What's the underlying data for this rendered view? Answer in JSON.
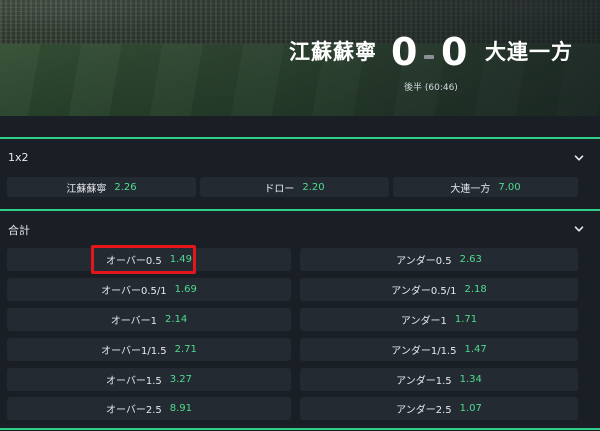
{
  "match": {
    "home_team": "江蘇蘇寧",
    "away_team": "大連一方",
    "home_score": "0",
    "away_score": "0",
    "status": "後半 (60:46)"
  },
  "markets": [
    {
      "title": "1x2",
      "outcomes": [
        {
          "label": "江蘇蘇寧",
          "odds": "2.26"
        },
        {
          "label": "ドロー",
          "odds": "2.20"
        },
        {
          "label": "大連一方",
          "odds": "7.00"
        }
      ]
    },
    {
      "title": "合計",
      "rows": [
        [
          {
            "label": "オーバー0.5",
            "odds": "1.49"
          },
          {
            "label": "アンダー0.5",
            "odds": "2.63"
          }
        ],
        [
          {
            "label": "オーバー0.5/1",
            "odds": "1.69"
          },
          {
            "label": "アンダー0.5/1",
            "odds": "2.18"
          }
        ],
        [
          {
            "label": "オーバー1",
            "odds": "2.14"
          },
          {
            "label": "アンダー1",
            "odds": "1.71"
          }
        ],
        [
          {
            "label": "オーバー1/1.5",
            "odds": "2.71"
          },
          {
            "label": "アンダー1/1.5",
            "odds": "1.47"
          }
        ],
        [
          {
            "label": "オーバー1.5",
            "odds": "3.27"
          },
          {
            "label": "アンダー1.5",
            "odds": "1.34"
          }
        ],
        [
          {
            "label": "オーバー2.5",
            "odds": "8.91"
          },
          {
            "label": "アンダー2.5",
            "odds": "1.07"
          }
        ]
      ]
    }
  ],
  "icons": {
    "collapse": "chevron-down-icon"
  },
  "colors": {
    "accent": "#2ecf87",
    "odds": "#4fdb8f",
    "highlight": "#e5161b",
    "background": "#1a1f26",
    "cell": "#242a32"
  }
}
